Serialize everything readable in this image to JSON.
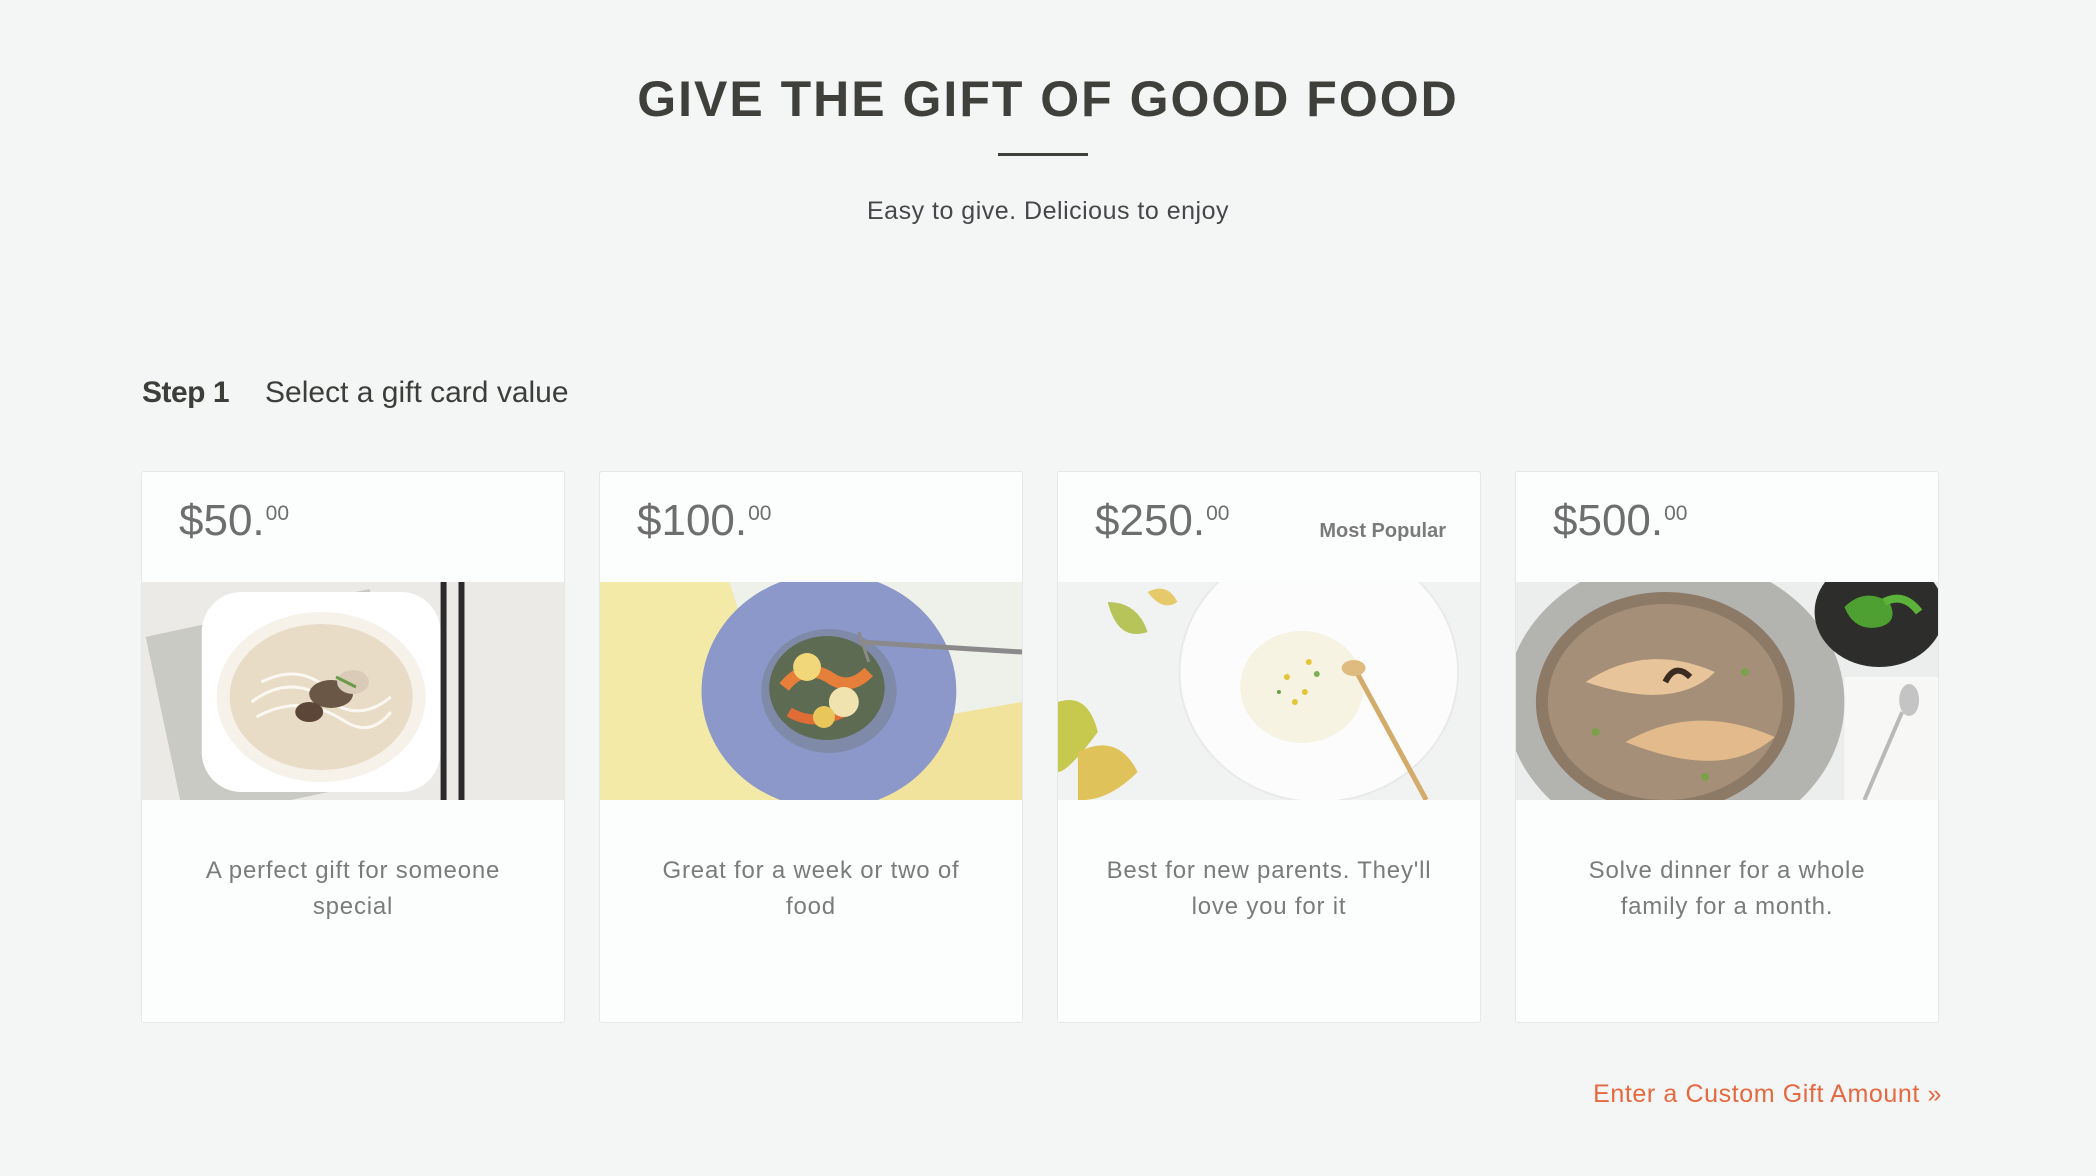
{
  "hero": {
    "title": "GIVE THE GIFT OF GOOD FOOD",
    "subtitle": "Easy to give. Delicious to enjoy"
  },
  "step": {
    "number": "Step 1",
    "label": "Select a gift card value"
  },
  "cards": [
    {
      "dollars": "$50.",
      "cents": "00",
      "badge": "",
      "description": "A perfect gift for someone special",
      "photo": "soup-noodles-image"
    },
    {
      "dollars": "$100.",
      "cents": "00",
      "badge": "",
      "description": "Great for a week or two of food",
      "photo": "vegetable-pasta-image"
    },
    {
      "dollars": "$250.",
      "cents": "00",
      "badge": "Most Popular",
      "description": "Best for new parents. They'll love you for it",
      "photo": "creamy-soup-image"
    },
    {
      "dollars": "$500.",
      "cents": "00",
      "badge": "",
      "description": "Solve dinner for a whole family for a month.",
      "photo": "fish-risotto-image"
    }
  ],
  "custom_link": "Enter a Custom Gift Amount »",
  "colors": {
    "background": "#f4f6f6",
    "card": "#fcfdfd",
    "accent_link": "#e5683f",
    "heading": "#3f3f3c"
  }
}
